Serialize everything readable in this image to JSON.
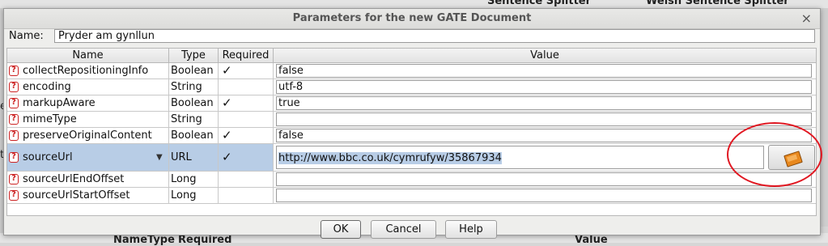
{
  "background": {
    "top_items": [
      "Sentence Splitter",
      "Welsh Sentence Splitter"
    ],
    "side_chars": [
      "e",
      "t"
    ],
    "bottom_headers": [
      "Name",
      "Type",
      "Required",
      "Value"
    ]
  },
  "dialog": {
    "title": "Parameters for the new GATE Document",
    "close_glyph": "×",
    "name_label": "Name:",
    "name_value": "Pryder am gynllun"
  },
  "table": {
    "headers": [
      "Name",
      "Type",
      "Required",
      "Value"
    ],
    "rows": [
      {
        "name": "collectRepositioningInfo",
        "type": "Boolean",
        "required": "✓",
        "value": "false"
      },
      {
        "name": "encoding",
        "type": "String",
        "required": "",
        "value": "utf-8"
      },
      {
        "name": "markupAware",
        "type": "Boolean",
        "required": "✓",
        "value": "true"
      },
      {
        "name": "mimeType",
        "type": "String",
        "required": "",
        "value": ""
      },
      {
        "name": "preserveOriginalContent",
        "type": "Boolean",
        "required": "✓",
        "value": "false"
      },
      {
        "name": "sourceUrl",
        "type": "URL",
        "required": "✓",
        "value": "http://www.bbc.co.uk/cymrufyw/35867934"
      },
      {
        "name": "sourceUrlEndOffset",
        "type": "Long",
        "required": "",
        "value": ""
      },
      {
        "name": "sourceUrlStartOffset",
        "type": "Long",
        "required": "",
        "value": ""
      }
    ],
    "param_icon_glyph": "?",
    "dropdown_glyph": "▼"
  },
  "buttons": {
    "ok": "OK",
    "cancel": "Cancel",
    "help": "Help"
  },
  "colors": {
    "selection": "#b8cde6",
    "annotation": "#e01822",
    "icon_red": "#cc2222"
  }
}
